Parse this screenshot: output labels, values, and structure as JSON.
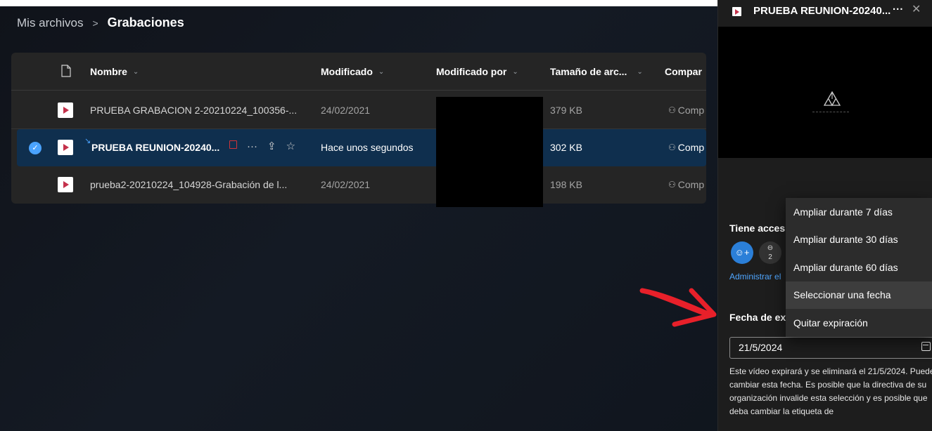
{
  "breadcrumb": {
    "root": "Mis archivos",
    "separator": ">",
    "current": "Grabaciones"
  },
  "columns": {
    "name": "Nombre",
    "modified": "Modificado",
    "modified_by": "Modificado por",
    "file_size": "Tamaño de arc...",
    "sharing": "Compar"
  },
  "files": [
    {
      "name": "PRUEBA GRABACION 2-20210224_100356-...",
      "modified": "24/02/2021",
      "size": "379 KB",
      "sharing": "Comp",
      "selected": false
    },
    {
      "name": "PRUEBA REUNION-20240...",
      "modified": "Hace unos segundos",
      "size": "302 KB",
      "sharing": "Comp",
      "selected": true
    },
    {
      "name": "prueba2-20210224_104928-Grabación de l...",
      "modified": "24/02/2021",
      "size": "198 KB",
      "sharing": "Comp",
      "selected": false
    }
  ],
  "panel": {
    "title": "PRUEBA REUNION-20240...",
    "more": "...",
    "close": "✕",
    "access_title": "Tiene acces",
    "link_count": "2",
    "manage_link": "Administrar el",
    "expiration_title": "Fecha de ex",
    "expiration_date": "21/5/2024",
    "expiration_description": "Este vídeo expirará y se eliminará el 21/5/2024. Puede cambiar esta fecha. Es posible que la directiva de su organización invalide esta selección y es posible que deba cambiar la etiqueta de"
  },
  "dropdown": {
    "items": [
      "Ampliar durante 7 días",
      "Ampliar durante 30 días",
      "Ampliar durante 60 días",
      "Seleccionar una fecha",
      "Quitar expiración"
    ],
    "highlighted_index": 3
  },
  "colors": {
    "accent": "#4aa3ff",
    "selected_row": "#0f2f4e",
    "file_icon_play": "#c4314b",
    "annotation_arrow": "#e8202a"
  },
  "icons": [
    "document-icon",
    "video-file-icon",
    "check-icon",
    "sensitivity-label-icon",
    "more-icon",
    "share-icon",
    "star-icon",
    "people-icon",
    "add-person-icon",
    "link-icon",
    "calendar-icon",
    "close-icon",
    "chevron-down-icon"
  ]
}
